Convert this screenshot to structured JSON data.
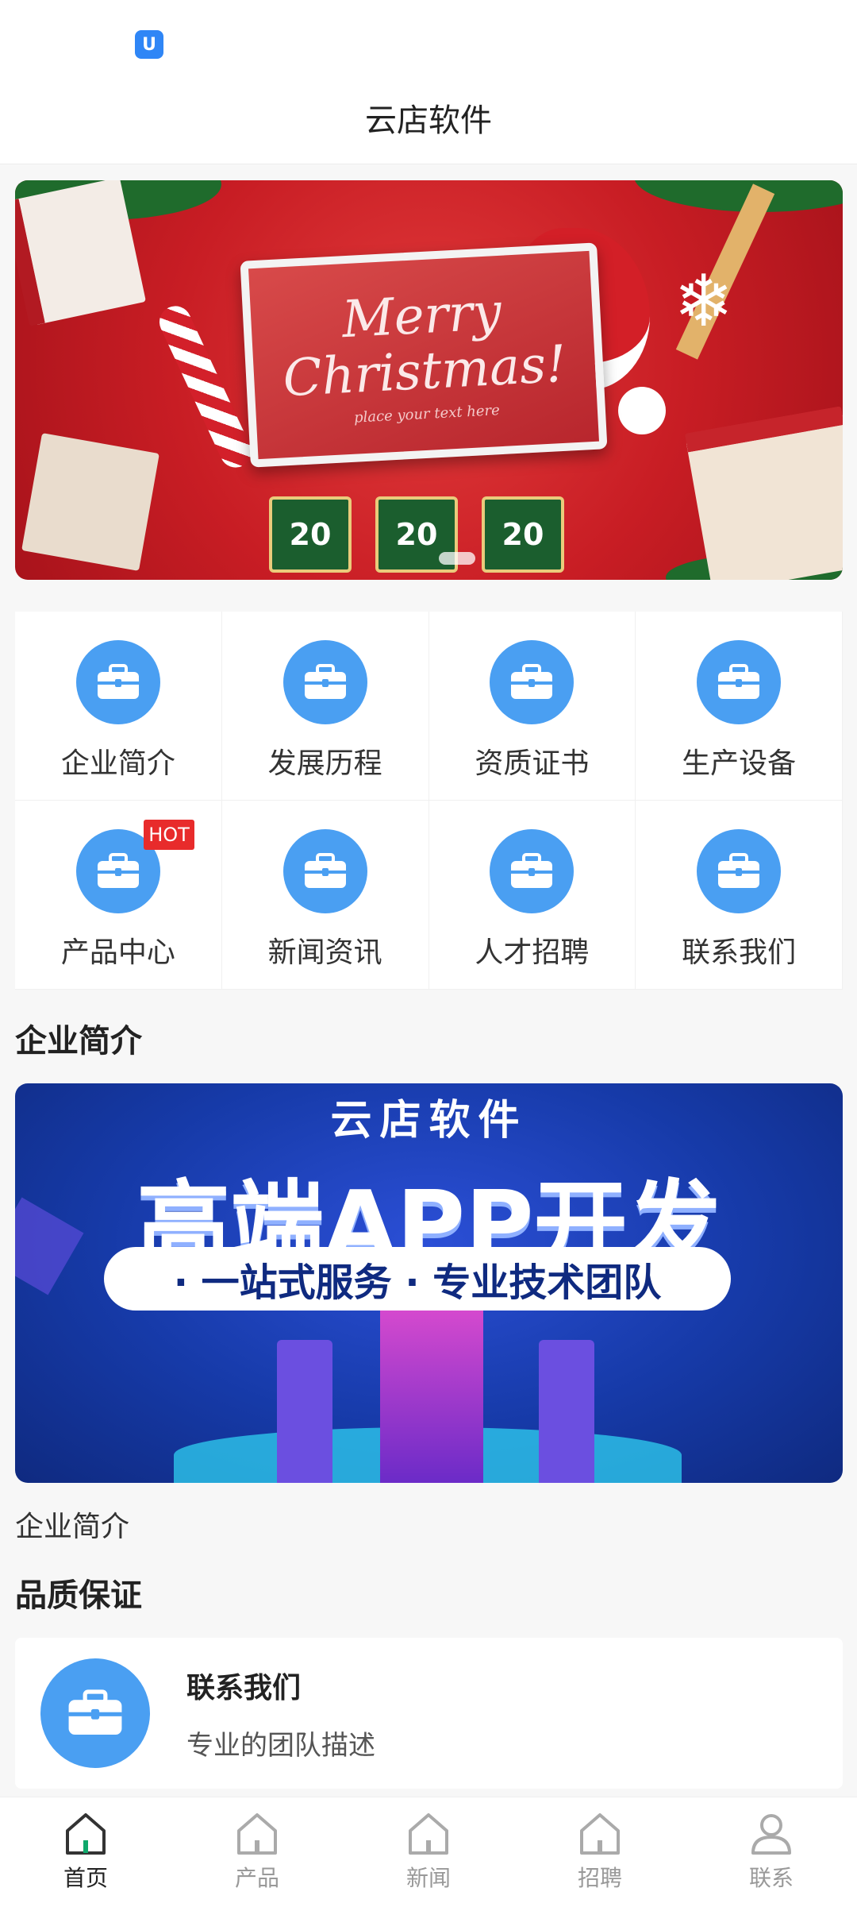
{
  "app": {
    "status_icon_glyph": "U",
    "title": "云店软件"
  },
  "banner": {
    "greeting_line1": "Merry",
    "greeting_line2": "Christmas!",
    "greeting_sub": "place your text here",
    "tiles": [
      "20",
      "20",
      "20"
    ]
  },
  "grid": {
    "items": [
      {
        "label": "企业简介",
        "icon": "briefcase-icon"
      },
      {
        "label": "发展历程",
        "icon": "briefcase-icon"
      },
      {
        "label": "资质证书",
        "icon": "briefcase-icon"
      },
      {
        "label": "生产设备",
        "icon": "briefcase-icon"
      },
      {
        "label": "产品中心",
        "icon": "briefcase-icon",
        "badge": "HOT"
      },
      {
        "label": "新闻资讯",
        "icon": "briefcase-icon"
      },
      {
        "label": "人才招聘",
        "icon": "briefcase-icon"
      },
      {
        "label": "联系我们",
        "icon": "briefcase-icon"
      }
    ]
  },
  "sections": {
    "intro_title": "企业简介",
    "intro_caption": "企业简介",
    "quality_title": "品质保证"
  },
  "promo": {
    "brand": "云店软件",
    "headline": "高端APP开发",
    "tagline": "· 一站式服务 · 专业技术团队"
  },
  "contact_card": {
    "title": "联系我们",
    "description": "专业的团队描述",
    "icon": "briefcase-icon"
  },
  "bottom_nav": {
    "items": [
      {
        "label": "首页",
        "icon": "home-icon",
        "active": true
      },
      {
        "label": "产品",
        "icon": "home-icon",
        "active": false
      },
      {
        "label": "新闻",
        "icon": "home-icon",
        "active": false
      },
      {
        "label": "招聘",
        "icon": "home-icon",
        "active": false
      },
      {
        "label": "联系",
        "icon": "user-icon",
        "active": false
      }
    ]
  },
  "colors": {
    "accent_blue": "#4a9ff2",
    "hot_red": "#e82b2b",
    "active_nav_icon": "#0fa86b"
  }
}
